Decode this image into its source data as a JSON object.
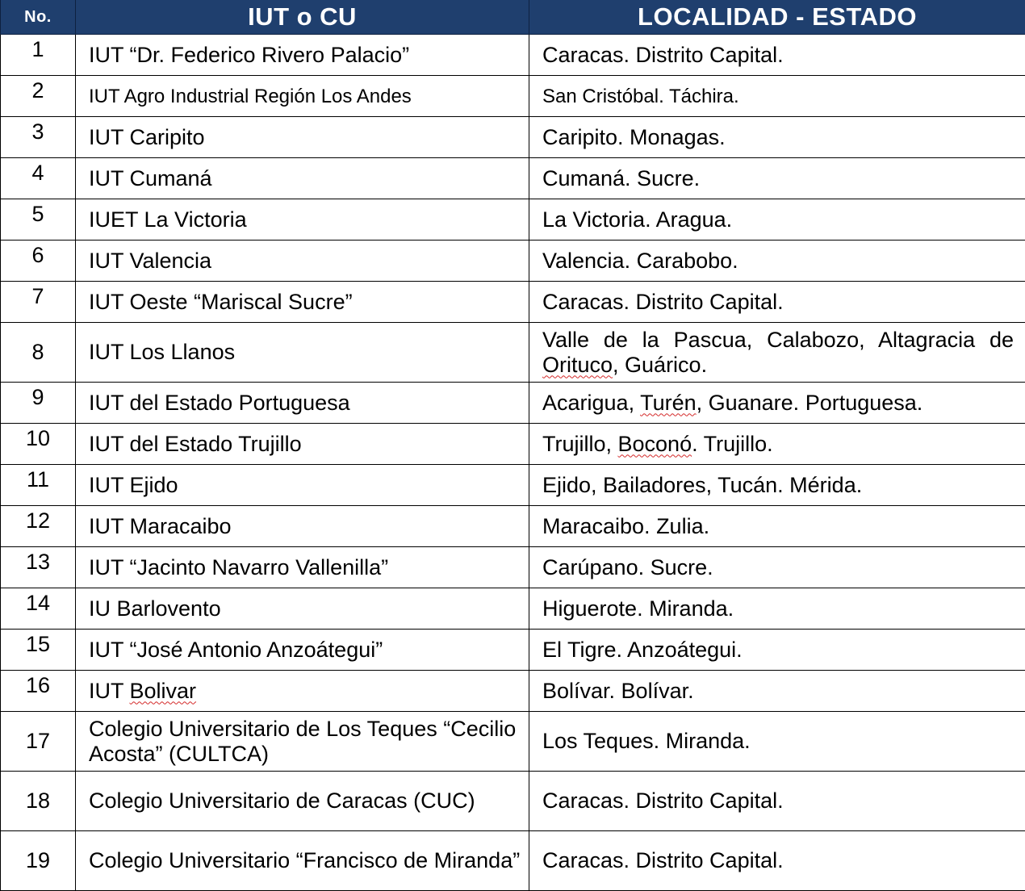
{
  "headers": {
    "no": "No.",
    "name": "IUT o CU",
    "location": "LOCALIDAD - ESTADO"
  },
  "rows": [
    {
      "no": "1",
      "name": "IUT “Dr. Federico Rivero Palacio”",
      "location": "Caracas. Distrito Capital."
    },
    {
      "no": "2",
      "name": "IUT Agro Industrial Región Los Andes",
      "location": "San Cristóbal. Táchira."
    },
    {
      "no": "3",
      "name": "IUT Caripito",
      "location": "Caripito. Monagas."
    },
    {
      "no": "4",
      "name": "IUT Cumaná",
      "location": "Cumaná. Sucre."
    },
    {
      "no": "5",
      "name": "IUET La Victoria",
      "location": "La Victoria. Aragua."
    },
    {
      "no": "6",
      "name": "IUT Valencia",
      "location": "Valencia. Carabobo."
    },
    {
      "no": "7",
      "name": "IUT Oeste “Mariscal Sucre”",
      "location": "Caracas. Distrito Capital."
    },
    {
      "no": "8",
      "name": "IUT Los Llanos",
      "location_a": "Valle de la Pascua, Calabozo, Altagracia de ",
      "location_b": "Orituco",
      "location_c": ", Guárico."
    },
    {
      "no": "9",
      "name": "IUT del Estado Portuguesa",
      "location_a": "Acarigua, ",
      "location_b": "Turén",
      "location_c": ", Guanare. Portuguesa."
    },
    {
      "no": "10",
      "name": "IUT del Estado Trujillo",
      "location_a": "Trujillo, ",
      "location_b": "Boconó",
      "location_c": ". Trujillo."
    },
    {
      "no": "11",
      "name": "IUT Ejido",
      "location": "Ejido, Bailadores, Tucán. Mérida."
    },
    {
      "no": "12",
      "name": "IUT Maracaibo",
      "location": "Maracaibo. Zulia."
    },
    {
      "no": "13",
      "name": "IUT “Jacinto Navarro Vallenilla”",
      "location": "Carúpano. Sucre."
    },
    {
      "no": "14",
      "name": "IU Barlovento",
      "location": "Higuerote. Miranda."
    },
    {
      "no": "15",
      "name": "IUT “José Antonio Anzoátegui”",
      "location": "El Tigre. Anzoátegui."
    },
    {
      "no": "16",
      "name_a": "IUT ",
      "name_b": "Bolivar",
      "location": "Bolívar. Bolívar."
    },
    {
      "no": "17",
      "name": "Colegio Universitario de Los Teques “Cecilio Acosta” (CULTCA)",
      "location": "Los Teques. Miranda."
    },
    {
      "no": "18",
      "name": "Colegio Universitario de Caracas (CUC)",
      "location": "Caracas. Distrito Capital."
    },
    {
      "no": "19",
      "name": "Colegio Universitario “Francisco de Miranda”",
      "location": "Caracas. Distrito Capital."
    }
  ]
}
